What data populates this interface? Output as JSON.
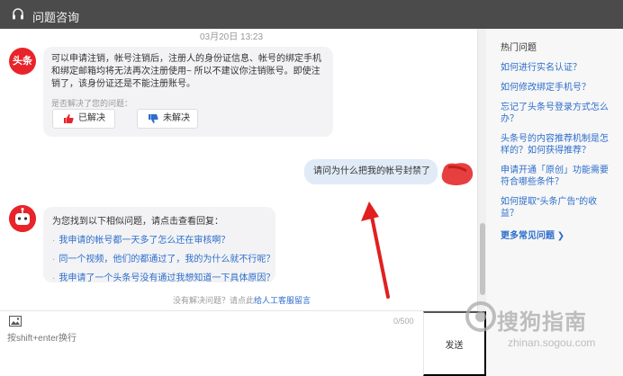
{
  "titlebar": {
    "title": "问题咨询",
    "icon": "headset-icon"
  },
  "chat": {
    "timestamp": "03月20日 13:23",
    "bot_brand": "头条",
    "message1": "可以申请注销，帐号注销后，注册人的身份证信息、帐号的绑定手机和绑定邮箱均将无法再次注册使用~ 所以不建议你注销账号。即使注销了，该身份证还是不能注册账号。",
    "solved_question": "是否解决了您的问题：",
    "solved_btn": "已解决",
    "unsolved_btn": "未解决",
    "user_message": "请问为什么把我的帐号封禁了",
    "similar_header": "为您找到以下相似问题，请点击查看回复：",
    "similar_links": [
      "我申请的帐号都一天多了怎么还在审核啊？",
      "同一个视频，他们的都通过了，我的为什么就不行呢？",
      "我申请了一个头条号没有通过我想知道一下具体原因？"
    ],
    "no_answer_prefix": "没有解决问题？请点此",
    "no_answer_link": "给人工客服留言"
  },
  "sidepanel": {
    "heading": "热门问题",
    "questions": [
      "如何进行实名认证？",
      "如何修改绑定手机号？",
      "忘记了头条号登录方式怎么办？",
      "头条号的内容推荐机制是怎样的？如何获得推荐？",
      "申请开通「原创」功能需要符合哪些条件？",
      "如何提取\"头条广告\"的收益？"
    ],
    "more": "更多常见问题"
  },
  "input": {
    "counter": "0/500",
    "placeholder": "按shift+enter换行",
    "send_label": "发送"
  },
  "watermark": {
    "title": "搜狗指南",
    "url": "zhinan.sogou.com"
  },
  "colors": {
    "titlebar": "#4b4b4b",
    "brand_red": "#e8242a",
    "link_blue": "#2d6ecb",
    "user_bubble": "#e0ebf7",
    "annotation_arrow": "#e02020"
  }
}
